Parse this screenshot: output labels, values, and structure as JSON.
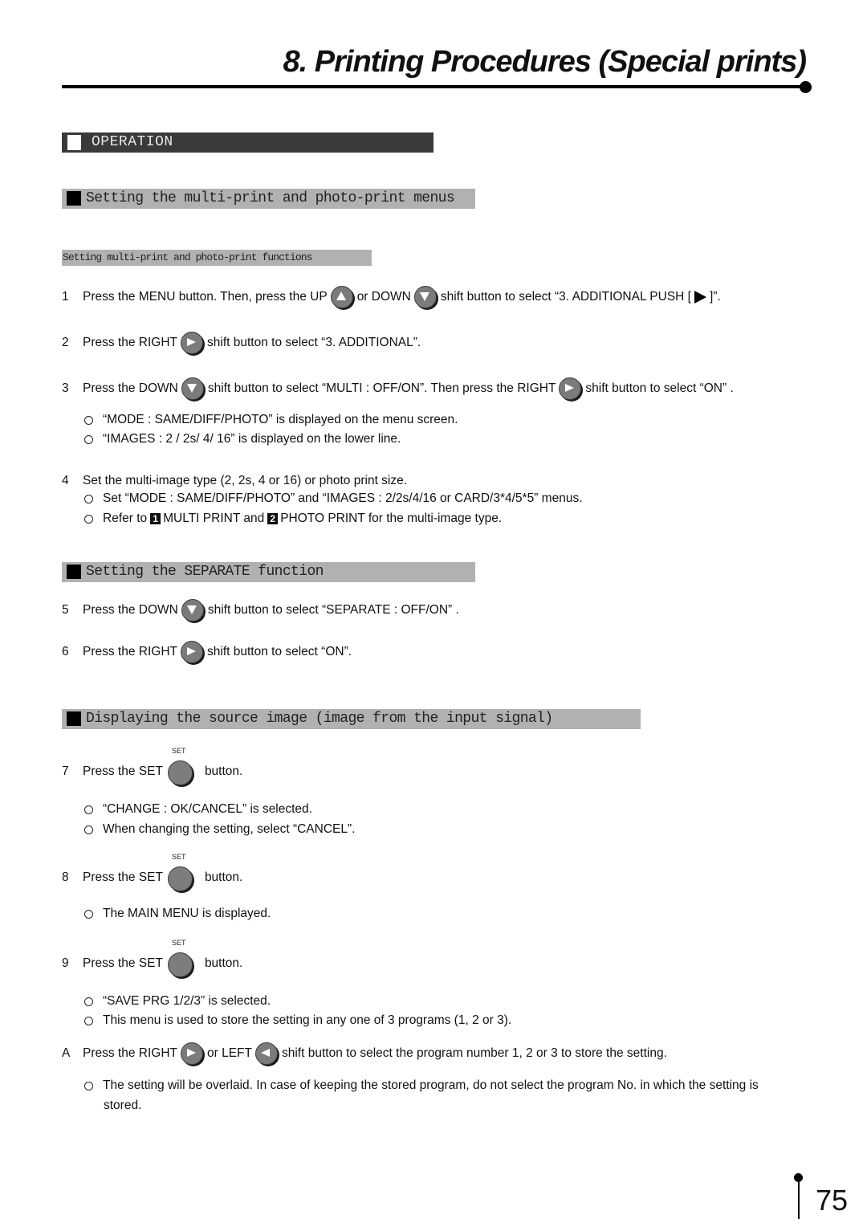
{
  "header": {
    "title": "8. Printing Procedures (Special prints)"
  },
  "section": {
    "label": "OPERATION"
  },
  "subsections": [
    {
      "title": "Setting the multi-print and photo-print menus"
    },
    {
      "title": "Setting the SEPARATE function"
    },
    {
      "title": "Displaying the source image (image from the input signal)"
    }
  ],
  "subheading": "Setting multi-print and photo-print functions",
  "icons": {
    "up": "up-arrow-button-icon",
    "down": "down-arrow-button-icon",
    "right": "right-arrow-button-icon",
    "left": "left-arrow-button-icon",
    "set": "set-button-icon",
    "bullet": "circle-bullet-icon"
  },
  "set_button_label": "SET",
  "steps": [
    {
      "num": "1",
      "parts": [
        "Press the MENU button.  Then, press the UP",
        "or DOWN",
        "shift button to select “3. ADDITIONAL  PUSH [",
        "]”."
      ]
    },
    {
      "num": "2",
      "parts": [
        "Press the RIGHT",
        "shift button to select “3. ADDITIONAL”."
      ]
    },
    {
      "num": "3",
      "parts": [
        "Press the DOWN",
        "shift button to select “MULTI  : OFF/ON”. Then press the RIGHT",
        "shift button to select “ON” ."
      ],
      "bullets": [
        "“MODE  : SAME/DIFF/PHOTO”  is displayed on the menu screen.",
        "“IMAGES  : 2 / 2s/ 4/ 16”  is displayed on the lower line."
      ]
    },
    {
      "num": "4",
      "parts": [
        "Set the multi-image type (2, 2s, 4 or 16) or photo print size."
      ],
      "bullets": [
        "Set “MODE : SAME/DIFF/PHOTO” and “IMAGES : 2/2s/4/16 or CARD/3*4/5*5” menus."
      ],
      "refer": {
        "prefix": "Refer to",
        "box1": "1",
        "mid": "MULTI PRINT and",
        "box2": "2",
        "suffix": "PHOTO PRINT for the multi-image type."
      }
    },
    {
      "num": "5",
      "parts": [
        "Press the DOWN",
        "shift button to select “SEPARATE : OFF/ON” ."
      ]
    },
    {
      "num": "6",
      "parts": [
        "Press the RIGHT",
        "shift button to select “ON”."
      ]
    },
    {
      "num": "7",
      "parts": [
        "Press the SET",
        "button."
      ],
      "bullets": [
        "“CHANGE : OK/CANCEL” is selected.",
        "When changing the setting, select “CANCEL”."
      ]
    },
    {
      "num": "8",
      "parts": [
        "Press the SET",
        "button."
      ],
      "bullets": [
        "The MAIN MENU is displayed."
      ]
    },
    {
      "num": "9",
      "parts": [
        "Press the SET",
        "button."
      ],
      "bullets": [
        "“SAVE PRG 1/2/3” is selected.",
        "This menu is used to store the setting in any one of 3 programs (1, 2 or 3)."
      ]
    },
    {
      "num": "A",
      "parts": [
        "Press the RIGHT",
        "or LEFT",
        "shift button to select the program number 1, 2 or 3 to store the setting."
      ],
      "bullets": [
        "The setting will be overlaid.  In case of keeping the stored program, do not select the program No. in which the setting is",
        "stored."
      ]
    }
  ],
  "page_number": "75"
}
